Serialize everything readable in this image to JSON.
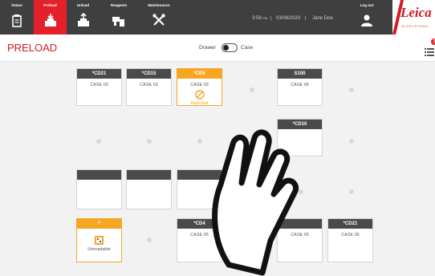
{
  "nav": {
    "items": [
      {
        "label": "Status",
        "icon": "status-icon"
      },
      {
        "label": "Preload",
        "icon": "preload-icon",
        "active": true
      },
      {
        "label": "Unload",
        "icon": "unload-icon"
      },
      {
        "label": "Reagents",
        "icon": "reagents-icon"
      },
      {
        "label": "Maintenance",
        "icon": "maintenance-icon"
      }
    ]
  },
  "header": {
    "time": "3:59",
    "ampm": "PM",
    "separator": "|",
    "date": "03/08/2020",
    "user": "Jane Doe",
    "logout_label": "Log out"
  },
  "brand": {
    "name": "Leica",
    "sub": "BIOSYSTEMS",
    "color": "#d21a23"
  },
  "page": {
    "title": "PRELOAD"
  },
  "toggle": {
    "left_label": "Drawer",
    "right_label": "Case"
  },
  "badge": {
    "count": "2"
  },
  "slots": [
    {
      "title": "*CD21",
      "case": "CASE 03",
      "state": "normal"
    },
    {
      "title": "*CD15",
      "case": "CASE 03",
      "state": "normal"
    },
    {
      "title": "*CD5",
      "case": "CASE 03",
      "state": "rejected",
      "status_text": "Rejected"
    },
    {
      "title": "S100",
      "case": "CASE 06",
      "state": "normal"
    },
    {
      "title": "*CD10",
      "case": "",
      "state": "normal"
    },
    {
      "title": "",
      "case": "",
      "state": "empty"
    },
    {
      "title": "",
      "case": "",
      "state": "empty"
    },
    {
      "title": "",
      "case": "",
      "state": "empty"
    },
    {
      "title": "?",
      "case": "",
      "state": "unreadable",
      "status_text": "Unreadable"
    },
    {
      "title": "*CD4",
      "case": "CASE 05",
      "state": "normal"
    },
    {
      "title": "",
      "case": "CASE 05",
      "state": "normal"
    },
    {
      "title": "*CD21",
      "case": "CASE 05",
      "state": "normal"
    }
  ],
  "colors": {
    "accent": "#e4202b",
    "warning": "#f6a623",
    "header_bg": "#3f3f3f",
    "slot_header": "#4a4a4a"
  }
}
